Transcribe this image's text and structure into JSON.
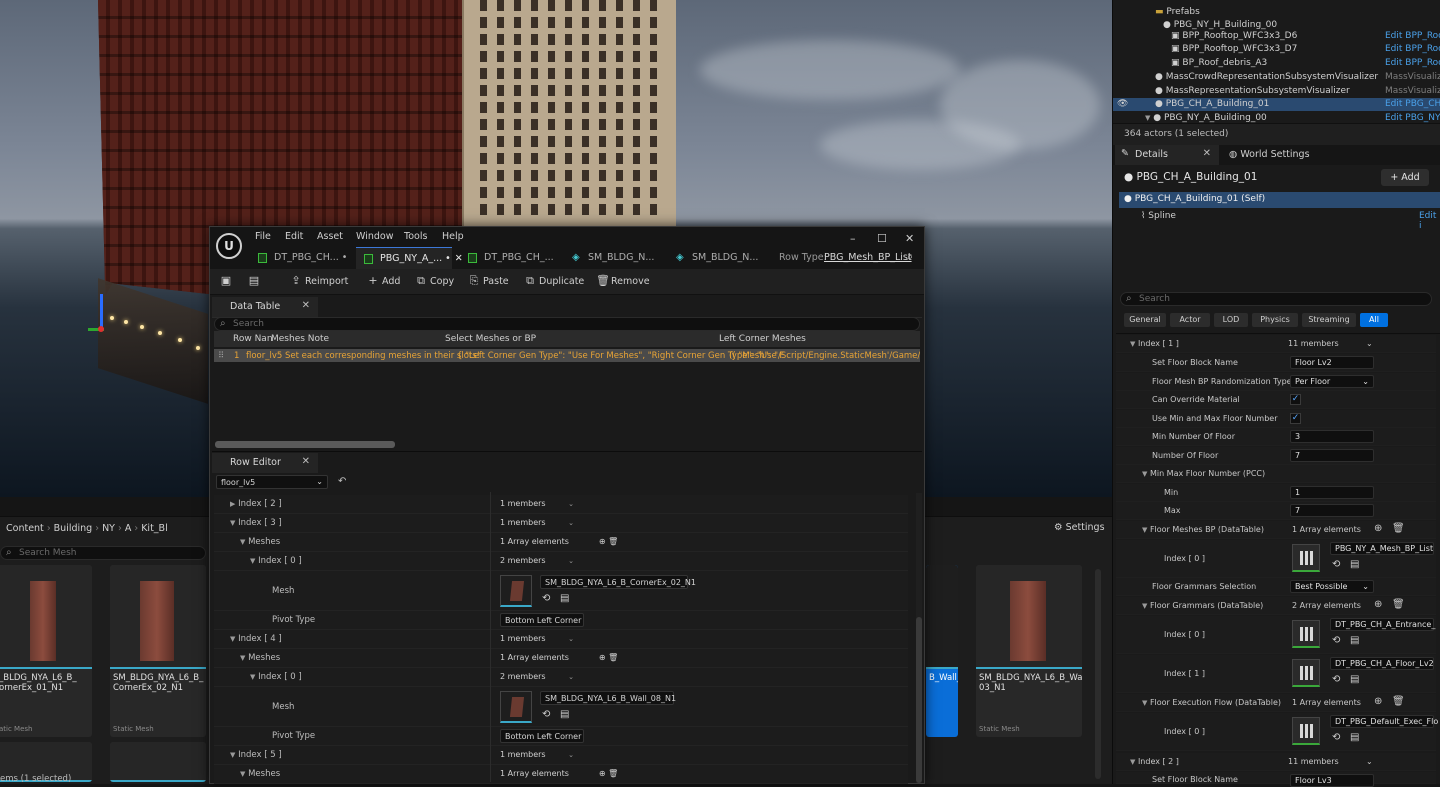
{
  "outliner": {
    "rows": [
      {
        "name": "",
        "type": ""
      },
      {
        "name": "Prefabs",
        "type": ""
      },
      {
        "name": "PBG_NY_H_Building_00",
        "type": ""
      },
      {
        "name": "BPP_Rooftop_WFC3x3_D6",
        "type": "Edit BPP_Roo"
      },
      {
        "name": "BPP_Rooftop_WFC3x3_D7",
        "type": "Edit BPP_Roo"
      },
      {
        "name": "BP_Roof_debris_A3",
        "type": "Edit BPP_Roof"
      },
      {
        "name": "MassCrowdRepresentationSubsystemVisualizer",
        "type": "MassVisualiz"
      },
      {
        "name": "MassRepresentationSubsystemVisualizer",
        "type": "MassVisualiz"
      },
      {
        "name": "PBG_CH_A_Building_01",
        "type": "Edit PBG_CH"
      },
      {
        "name": "PBG_NY_A_Building_00",
        "type": "Edit PBG_NY"
      }
    ],
    "actor_count": "364 actors (1 selected)"
  },
  "details": {
    "tab_details": "Details",
    "tab_world": "World Settings",
    "actor_name": "PBG_CH_A_Building_01",
    "add_label": "+ Add",
    "component_self": "PBG_CH_A_Building_01 (Self)",
    "component_spline": "Spline",
    "component_spline_edit": "Edit i",
    "search_placeholder": "Search",
    "filters": [
      "General",
      "Actor",
      "LOD",
      "Physics",
      "Streaming",
      "All"
    ],
    "index1": "Index [ 1 ]",
    "index1_members": "11 members",
    "props": {
      "set_floor_block_name": "Set Floor Block Name",
      "set_floor_block_name_val": "Floor Lv2",
      "floor_mesh_rand": "Floor Mesh BP Randomization Type",
      "floor_mesh_rand_val": "Per Floor",
      "can_override": "Can Override Material",
      "use_min_max": "Use Min and Max Floor Number",
      "min_floor": "Min Number Of Floor",
      "min_floor_val": "3",
      "num_floor": "Number Of Floor",
      "num_floor_val": "7",
      "min_max_pcc": "Min Max Floor Number (PCC)",
      "min": "Min",
      "min_val": "1",
      "max": "Max",
      "max_val": "7",
      "floor_meshes_bp": "Floor Meshes BP (DataTable)",
      "floor_meshes_bp_count": "1 Array elements",
      "idx0": "Index [ 0 ]",
      "idx1": "Index [ 1 ]",
      "floor_meshes_bp_val": "PBG_NY_A_Mesh_BP_List",
      "grammar_sel": "Floor Grammars Selection",
      "grammar_sel_val": "Best Possible",
      "grammars": "Floor Grammars (DataTable)",
      "grammars_count": "2 Array elements",
      "grammar0": "DT_PBG_CH_A_Entrance_",
      "grammar1": "DT_PBG_CH_A_Floor_Lv2",
      "exec_flow": "Floor Execution Flow (DataTable)",
      "exec_flow_count": "1 Array elements",
      "exec_flow_val": "DT_PBG_Default_Exec_Flo",
      "index2": "Index [ 2 ]",
      "index2_members": "11 members",
      "set_floor_block_name2_val": "Floor Lv3"
    }
  },
  "datatable_window": {
    "menu": [
      "File",
      "Edit",
      "Asset",
      "Window",
      "Tools",
      "Help"
    ],
    "tabs": [
      "DT_PBG_CH... •",
      "PBG_NY_A_... •",
      "DT_PBG_CH_...",
      "SM_BLDG_N...",
      "SM_BLDG_N..."
    ],
    "row_type_label": "Row Type:",
    "row_type_value": "PBG_Mesh_BP_List",
    "toolbar": {
      "reimport": "Reimport",
      "add": "Add",
      "copy": "Copy",
      "paste": "Paste",
      "duplicate": "Duplicate",
      "remove": "Remove"
    },
    "panel_datatable": "Data Table",
    "search_placeholder": "Search",
    "columns": [
      "Row Nan",
      "Meshes Note",
      "Select Meshes or BP",
      "Left Corner Meshes"
    ],
    "row": {
      "num": "1",
      "name": "floor_lv5",
      "note": "Set each corresponding meshes in their slots!",
      "select": "{ \"Left Corner Gen Type\": \"Use For Meshes\", \"Right Corner Gen Type\": \"Use F",
      "left": "(( \"Mesh\": \"/Script/Engine.StaticMesh'/Game/Building"
    },
    "panel_roweditor": "Row Editor",
    "row_select": "floor_lv5",
    "rows": [
      {
        "label": "Index [ 2 ]",
        "value": "1 members"
      },
      {
        "label": "Index [ 3 ]",
        "value": "1 members"
      },
      {
        "label": "Meshes",
        "value": "1 Array elements"
      },
      {
        "label": "Index [ 0 ]",
        "value": "2 members"
      },
      {
        "label": "Mesh",
        "value": "SM_BLDG_NYA_L6_B_CornerEx_02_N1"
      },
      {
        "label": "Pivot Type",
        "value": "Bottom Left Corner"
      },
      {
        "label": "Index [ 4 ]",
        "value": "1 members"
      },
      {
        "label": "Meshes",
        "value": "1 Array elements"
      },
      {
        "label": "Index [ 0 ]",
        "value": "2 members"
      },
      {
        "label": "Mesh",
        "value": "SM_BLDG_NYA_L6_B_Wall_08_N1"
      },
      {
        "label": "Pivot Type",
        "value": "Bottom Left Corner"
      },
      {
        "label": "Index [ 5 ]",
        "value": "1 members"
      },
      {
        "label": "Meshes",
        "value": "1 Array elements"
      }
    ]
  },
  "content_browser": {
    "breadcrumb": [
      "Content",
      "Building",
      "NY",
      "A",
      "Kit_Bl"
    ],
    "settings": "Settings",
    "search_placeholder": "Search Mesh",
    "cards": [
      {
        "name": "_BLDG_NYA_L6_B_\nornerEx_01_N1",
        "type": "atic Mesh"
      },
      {
        "name": "SM_BLDG_NYA_L6_B_\nCornerEx_02_N1",
        "type": "Static Mesh"
      },
      {
        "name": "B_Wall_",
        "type": ""
      },
      {
        "name": "SM_BLDG_NYA_L6_B_Wall_\n03_N1",
        "type": "Static Mesh"
      }
    ],
    "status": "ems (1 selected)"
  }
}
